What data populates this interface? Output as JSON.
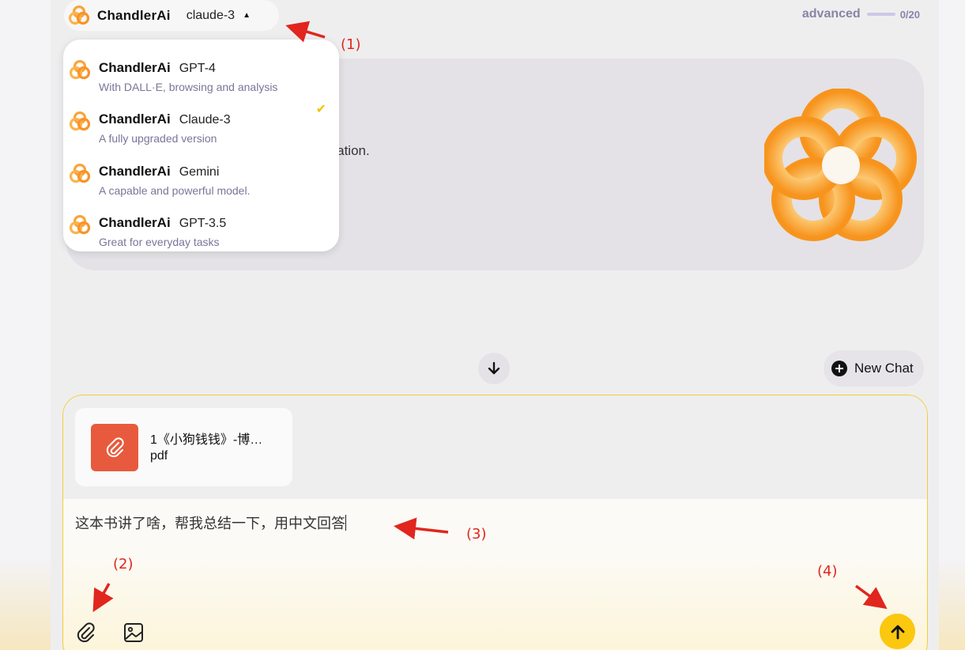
{
  "header": {
    "brand": "ChandlerAi",
    "current_model": "claude-3",
    "caret_icon": "▲",
    "usage_label": "advanced",
    "usage_count": "0/20",
    "usage_fraction": 0
  },
  "hero": {
    "visible_text": "eration."
  },
  "model_menu": {
    "items": [
      {
        "brand": "ChandlerAi",
        "model": "GPT-4",
        "description": "With DALL·E, browsing and analysis",
        "selected": false
      },
      {
        "brand": "ChandlerAi",
        "model": "Claude-3",
        "description": "A fully upgraded version",
        "selected": true
      },
      {
        "brand": "ChandlerAi",
        "model": "Gemini",
        "description": "A capable and powerful model.",
        "selected": false
      },
      {
        "brand": "ChandlerAi",
        "model": "GPT-3.5",
        "description": "Great for everyday tasks",
        "selected": false
      }
    ],
    "check_icon": "✔"
  },
  "actions": {
    "new_chat_label": "New Chat"
  },
  "composer": {
    "attachment": {
      "name": "1《小狗钱钱》-博…",
      "type": "pdf"
    },
    "input_value": "这本书讲了啥，帮我总结一下，用中文回答",
    "icons": [
      "paperclip-icon",
      "image-icon",
      "arrow-up-icon"
    ]
  },
  "annotations": [
    "(1)",
    "(2)",
    "(3)",
    "(4)"
  ],
  "colors": {
    "accent_yellow": "#fbc70f",
    "file_icon_bg": "#e85a3d",
    "annotation_red": "#e0261e",
    "usage_text": "#8a83a7"
  }
}
